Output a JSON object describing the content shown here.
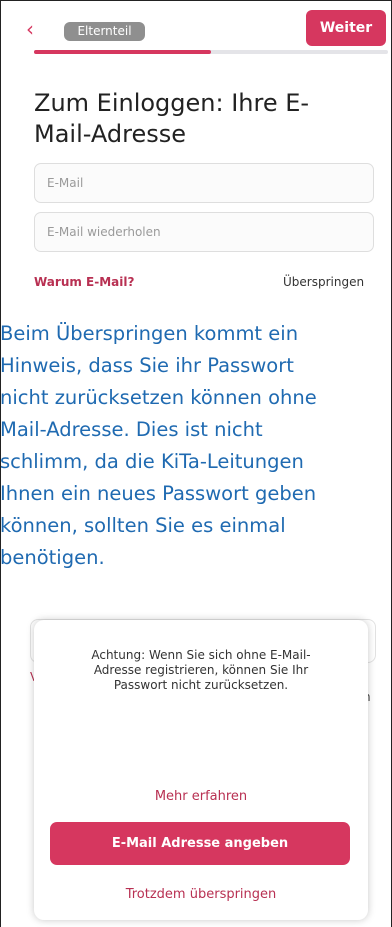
{
  "header": {
    "back_icon": "‹",
    "chip_label": "Elternteil",
    "next_label": "Weiter",
    "progress_fraction": 0.5,
    "accent": "#d6375f"
  },
  "main": {
    "title_line1": "Zum Einloggen: Ihre E-",
    "title_line2": "Mail-Adresse",
    "email_placeholder": "E-Mail",
    "email_repeat_placeholder": "E-Mail wiederholen",
    "why_link": "Warum E-Mail?",
    "skip_link": "Überspringen"
  },
  "note": {
    "lines": [
      "Beim Überspringen kommt ein",
      "Hinweis, dass Sie ihr Passwort",
      "nicht zurücksetzen können ohne",
      "Mail-Adresse. Dies ist nicht",
      "schlimm, da die KiTa-Leitungen",
      "Ihnen ein neues Passwort geben",
      "können, sollten Sie es einmal",
      "benötigen."
    ],
    "color": "#1f6ab1"
  },
  "background": {
    "partial_left": "V",
    "partial_right": "n"
  },
  "dialog": {
    "warning_line1": "Achtung: Wenn Sie sich ohne E-Mail-",
    "warning_line2": "Adresse registrieren, können Sie Ihr",
    "warning_line3": "Passwort nicht zurücksetzen.",
    "more_link": "Mehr erfahren",
    "primary_button": "E-Mail Adresse angeben",
    "secondary_link": "Trotzdem überspringen"
  }
}
